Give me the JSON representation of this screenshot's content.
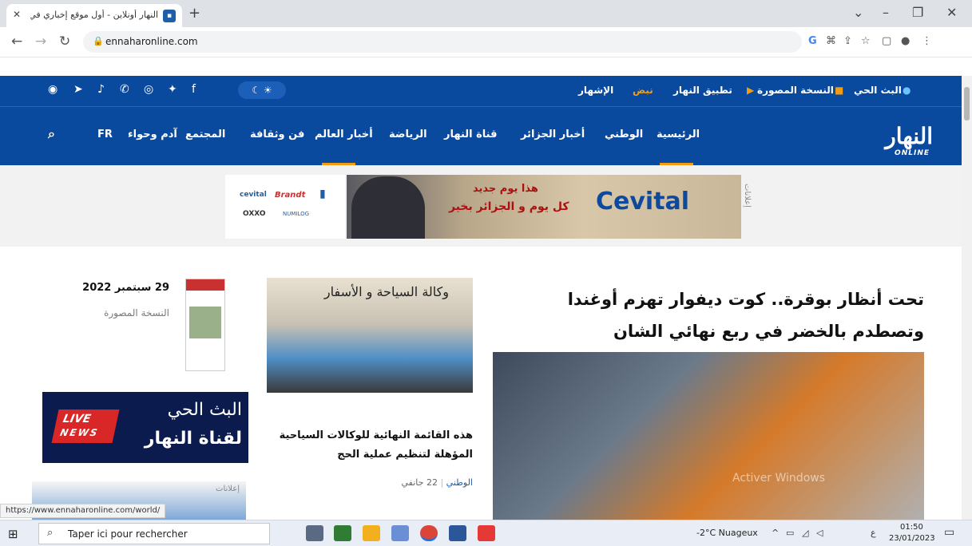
{
  "browser": {
    "tab_title": "النهار أونلاين - أول موقع إخباري في",
    "tab_favicon": "favicon",
    "url": "ennaharonline.com",
    "status_url": "https://www.ennaharonline.com/world/"
  },
  "topbar": {
    "live": "البث الحي",
    "paper": "النسخة المصورة",
    "app": "تطبيق النهار",
    "nabad": "نبض",
    "ads": "الإشهار"
  },
  "nav": {
    "logo": "النهار",
    "logo_sub": "ONLINE",
    "items": [
      "الرئيسية",
      "الوطني",
      "أخبار الجزائر",
      "قناة النهار",
      "الرياضة",
      "أخبار العالم",
      "فن وثقافة",
      "المجتمع",
      "آدم وحواء",
      "FR"
    ]
  },
  "ad": {
    "brand1": "Brandt",
    "brand2": "OXXO",
    "brand3": "NUMILOG",
    "banner_line1": "هذا يوم جديد",
    "banner_line2": "كل يوم و الجزائر بخير",
    "banner_brand": "Cevital",
    "label": "إعلانات"
  },
  "main": {
    "headline": "تحت أنظار بوقرة.. كوت ديفوار تهزم أوغندا وتصطدم بالخضر في ربع نهائي الشان",
    "watermark": "Activer Windows"
  },
  "side": {
    "title": "هذه القائمة النهائية للوكالات السياحية المؤهلة لتنظيم عملية الحج",
    "category": "الوطني",
    "date": "22 جانفي"
  },
  "paper": {
    "date": "29 سبتمبر 2022",
    "label": "النسخة المصورة"
  },
  "live_banner": {
    "badge1": "LIVE",
    "badge2": "NEWS",
    "title": "البث الحي",
    "subtitle": "لقناة النهار"
  },
  "ads_box": {
    "label": "إعلانات"
  },
  "taskbar": {
    "search_placeholder": "Taper ici pour rechercher",
    "weather": "-2°C  Nuageux",
    "time": "01:50",
    "date": "23/01/2023"
  }
}
